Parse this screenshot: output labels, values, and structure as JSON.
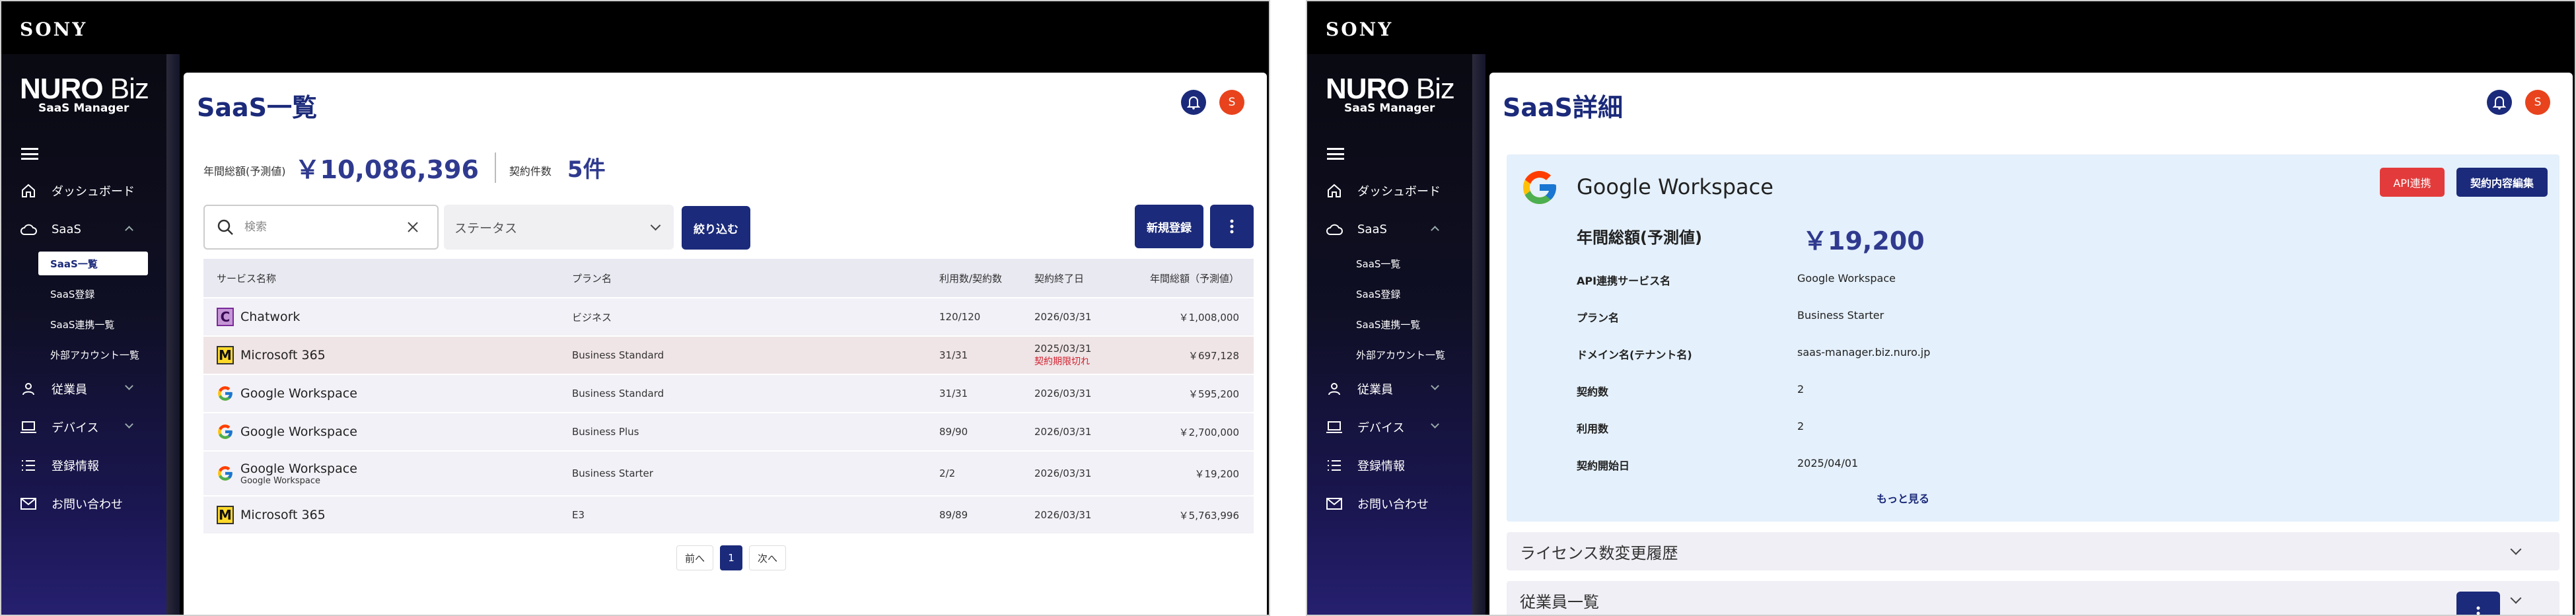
{
  "brand": "SONY",
  "sidebar": {
    "logo_main": "NURO",
    "logo_biz": " Biz",
    "logo_sub": "SaaS Manager",
    "items": {
      "dashboard": "ダッシュボード",
      "saas": "SaaS",
      "saas_list": "SaaS一覧",
      "saas_register": "SaaS登録",
      "saas_integration": "SaaS連携一覧",
      "external_accounts": "外部アカウント一覧",
      "employees": "従業員",
      "devices": "デバイス",
      "registration_info": "登録情報",
      "contact": "お問い合わせ"
    }
  },
  "header": {
    "avatar_initial": "S"
  },
  "list_page": {
    "title": "SaaS一覧",
    "annual_total_label": "年間総額(予測値)",
    "annual_total_value": "￥10,086,396",
    "contract_count_label": "契約件数",
    "contract_count_value": "5件",
    "search_placeholder": "検索",
    "status_placeholder": "ステータス",
    "filter_button": "絞り込む",
    "new_button": "新規登録",
    "columns": [
      "サービス名称",
      "プラン名",
      "利用数/契約数",
      "契約終了日",
      "年間総額（予測値）"
    ],
    "rows": [
      {
        "name": "Chatwork",
        "sub": "",
        "plan": "ビジネス",
        "usage": "120/120",
        "end": "2026/03/31",
        "end_note": "",
        "amount": "￥1,008,000"
      },
      {
        "name": "Microsoft 365",
        "sub": "",
        "plan": "Business Standard",
        "usage": "31/31",
        "end": "2025/03/31",
        "end_note": "契約期限切れ",
        "amount": "￥697,128"
      },
      {
        "name": "Google Workspace",
        "sub": "",
        "plan": "Business Standard",
        "usage": "31/31",
        "end": "2026/03/31",
        "end_note": "",
        "amount": "￥595,200"
      },
      {
        "name": "Google Workspace",
        "sub": "",
        "plan": "Business Plus",
        "usage": "89/90",
        "end": "2026/03/31",
        "end_note": "",
        "amount": "￥2,700,000"
      },
      {
        "name": "Google Workspace",
        "sub": "Google Workspace",
        "plan": "Business Starter",
        "usage": "2/2",
        "end": "2026/03/31",
        "end_note": "",
        "amount": "￥19,200"
      },
      {
        "name": "Microsoft 365",
        "sub": "",
        "plan": "E3",
        "usage": "89/89",
        "end": "2026/03/31",
        "end_note": "",
        "amount": "￥5,763,996"
      }
    ],
    "pager": {
      "prev": "前へ",
      "current": "1",
      "next": "次へ"
    }
  },
  "detail_page": {
    "title": "SaaS詳細",
    "service_name": "Google Workspace",
    "api_button": "API連携",
    "edit_button": "契約内容編集",
    "annual_total_label": "年間総額(予測値)",
    "annual_total_value": "￥19,200",
    "fields": [
      {
        "key": "API連携サービス名",
        "value": "Google Workspace"
      },
      {
        "key": "プラン名",
        "value": "Business Starter"
      },
      {
        "key": "ドメイン名(テナント名)",
        "value": "saas-manager.biz.nuro.jp"
      },
      {
        "key": "契約数",
        "value": "2"
      },
      {
        "key": "利用数",
        "value": "2"
      },
      {
        "key": "契約開始日",
        "value": "2025/04/01"
      }
    ],
    "more_link": "もっと見る",
    "license_history": "ライセンス数変更履歴",
    "employee_list": "従業員一覧"
  },
  "colors": {
    "navy": "#1b2a7a",
    "accent_red": "#e33b3b",
    "avatar_orange": "#e8431d"
  }
}
